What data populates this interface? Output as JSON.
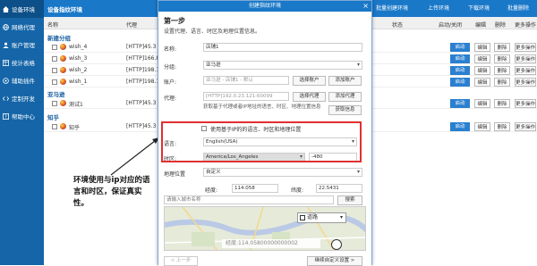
{
  "sidebar": {
    "items": [
      {
        "label": "设备环境",
        "icon": "home-icon"
      },
      {
        "label": "网络代理",
        "icon": "globe-icon"
      },
      {
        "label": "账户管理",
        "icon": "user-icon"
      },
      {
        "label": "统计表格",
        "icon": "table-icon"
      },
      {
        "label": "辅助插件",
        "icon": "plugin-icon"
      },
      {
        "label": "定制开发",
        "icon": "code-icon"
      },
      {
        "label": "帮助中心",
        "icon": "help-icon"
      }
    ]
  },
  "topbar": {
    "title": "设备指纹环境",
    "buttons": [
      "批量创建环境",
      "上传环境",
      "下载环境",
      "批量删除"
    ]
  },
  "table": {
    "headers": {
      "name": "名称",
      "proxy": "代理",
      "status": "状态",
      "start_close": "启动/关闭",
      "edit": "编辑",
      "delete": "删除",
      "more": "更多操作"
    },
    "groups": [
      {
        "name": "新建分组",
        "rows": [
          {
            "name": "wish_4",
            "proxy": "[HTTP]45.3"
          },
          {
            "name": "wish_3",
            "proxy": "[HTTP]166.8"
          },
          {
            "name": "wish_2",
            "proxy": "[HTTP]198.1"
          },
          {
            "name": "wish_1",
            "proxy": "[HTTP]198.1"
          }
        ]
      },
      {
        "name": "亚马逊",
        "rows": [
          {
            "name": "测试1",
            "proxy": "[HTTP]45.3"
          }
        ]
      },
      {
        "name": "知乎",
        "rows": [
          {
            "name": "知乎",
            "proxy": "[HTTP]45.3"
          }
        ]
      }
    ],
    "actions": {
      "start": "启动",
      "edit": "编辑",
      "delete": "删除",
      "more": "更多操作"
    }
  },
  "dialog": {
    "title": "创建指纹环境",
    "step_title": "第一步",
    "step_desc": "设置代理、语言、时区及地理位置信息。",
    "name_label": "名称:",
    "name_value": "店铺1",
    "group_label": "分组:",
    "group_value": "亚马逊",
    "account_label": "账户:",
    "account_value": "亚马逊 - 店铺1 - 默认",
    "select_account_btn": "选择账户",
    "add_account_btn": "添加账户",
    "proxy_label": "代理:",
    "proxy_value": "[HTTP]192.0.23.121:60099",
    "select_proxy_btn": "选择代理",
    "add_proxy_btn": "添加代理",
    "proxy_hint": "获取基于代理或者IP地址的语言、时区、地理位置信息",
    "fetch_info_btn": "获取信息",
    "use_ip_label": "使用基于IP的的语言、时区和地理位置",
    "language_label": "语言:",
    "language_value": "English(USA)",
    "timezone_label": "时区:",
    "timezone_value": "America/Los_Angeles",
    "timezone_offset": "-480",
    "geo_label": "地理位置",
    "geo_value": "自定义",
    "longitude_label": "经度:",
    "longitude_value": "114.058",
    "latitude_label": "纬度:",
    "latitude_value": "22.5431",
    "city_placeholder": "请输入城市名称",
    "search_btn": "搜索",
    "road_label": "道路",
    "coord_readout": "经度:114.05800000000002",
    "prev_btn": "< 上一步",
    "next_btn": "继续自定义设置 >"
  },
  "annotation": {
    "text": "环境使用与ip对应的语言和时区，保证真实性。"
  },
  "colors": {
    "sidebar": "#1565a8",
    "topbar": "#1a78c8",
    "highlight": "#e03030"
  }
}
